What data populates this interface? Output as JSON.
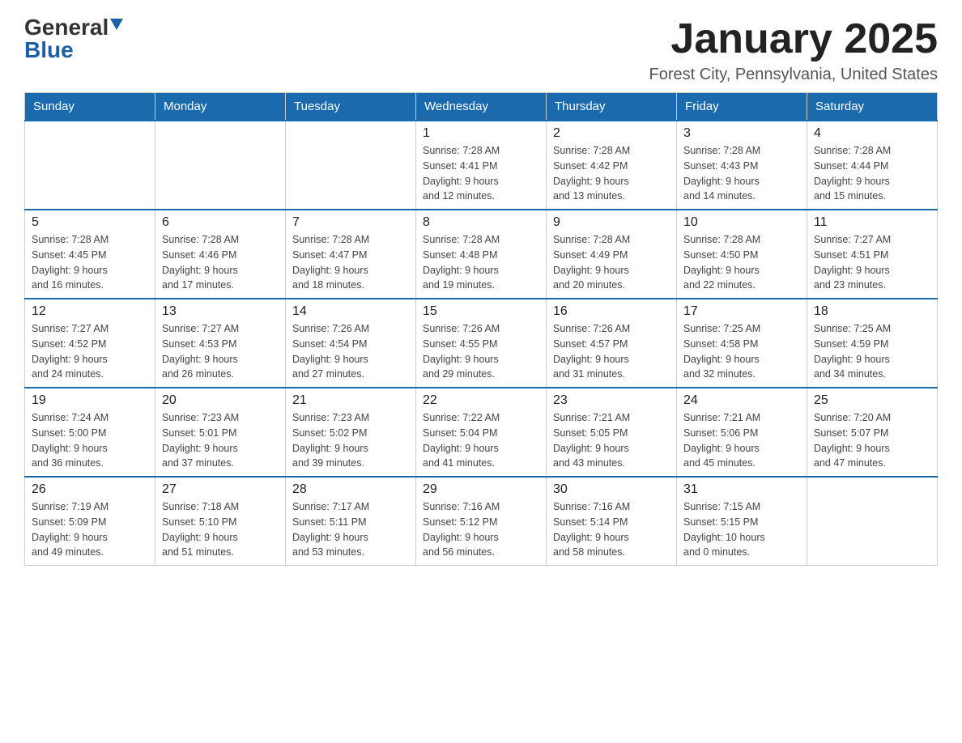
{
  "logo": {
    "general": "General",
    "blue": "Blue"
  },
  "header": {
    "title": "January 2025",
    "subtitle": "Forest City, Pennsylvania, United States"
  },
  "days_of_week": [
    "Sunday",
    "Monday",
    "Tuesday",
    "Wednesday",
    "Thursday",
    "Friday",
    "Saturday"
  ],
  "weeks": [
    [
      {
        "day": "",
        "info": ""
      },
      {
        "day": "",
        "info": ""
      },
      {
        "day": "",
        "info": ""
      },
      {
        "day": "1",
        "info": "Sunrise: 7:28 AM\nSunset: 4:41 PM\nDaylight: 9 hours\nand 12 minutes."
      },
      {
        "day": "2",
        "info": "Sunrise: 7:28 AM\nSunset: 4:42 PM\nDaylight: 9 hours\nand 13 minutes."
      },
      {
        "day": "3",
        "info": "Sunrise: 7:28 AM\nSunset: 4:43 PM\nDaylight: 9 hours\nand 14 minutes."
      },
      {
        "day": "4",
        "info": "Sunrise: 7:28 AM\nSunset: 4:44 PM\nDaylight: 9 hours\nand 15 minutes."
      }
    ],
    [
      {
        "day": "5",
        "info": "Sunrise: 7:28 AM\nSunset: 4:45 PM\nDaylight: 9 hours\nand 16 minutes."
      },
      {
        "day": "6",
        "info": "Sunrise: 7:28 AM\nSunset: 4:46 PM\nDaylight: 9 hours\nand 17 minutes."
      },
      {
        "day": "7",
        "info": "Sunrise: 7:28 AM\nSunset: 4:47 PM\nDaylight: 9 hours\nand 18 minutes."
      },
      {
        "day": "8",
        "info": "Sunrise: 7:28 AM\nSunset: 4:48 PM\nDaylight: 9 hours\nand 19 minutes."
      },
      {
        "day": "9",
        "info": "Sunrise: 7:28 AM\nSunset: 4:49 PM\nDaylight: 9 hours\nand 20 minutes."
      },
      {
        "day": "10",
        "info": "Sunrise: 7:28 AM\nSunset: 4:50 PM\nDaylight: 9 hours\nand 22 minutes."
      },
      {
        "day": "11",
        "info": "Sunrise: 7:27 AM\nSunset: 4:51 PM\nDaylight: 9 hours\nand 23 minutes."
      }
    ],
    [
      {
        "day": "12",
        "info": "Sunrise: 7:27 AM\nSunset: 4:52 PM\nDaylight: 9 hours\nand 24 minutes."
      },
      {
        "day": "13",
        "info": "Sunrise: 7:27 AM\nSunset: 4:53 PM\nDaylight: 9 hours\nand 26 minutes."
      },
      {
        "day": "14",
        "info": "Sunrise: 7:26 AM\nSunset: 4:54 PM\nDaylight: 9 hours\nand 27 minutes."
      },
      {
        "day": "15",
        "info": "Sunrise: 7:26 AM\nSunset: 4:55 PM\nDaylight: 9 hours\nand 29 minutes."
      },
      {
        "day": "16",
        "info": "Sunrise: 7:26 AM\nSunset: 4:57 PM\nDaylight: 9 hours\nand 31 minutes."
      },
      {
        "day": "17",
        "info": "Sunrise: 7:25 AM\nSunset: 4:58 PM\nDaylight: 9 hours\nand 32 minutes."
      },
      {
        "day": "18",
        "info": "Sunrise: 7:25 AM\nSunset: 4:59 PM\nDaylight: 9 hours\nand 34 minutes."
      }
    ],
    [
      {
        "day": "19",
        "info": "Sunrise: 7:24 AM\nSunset: 5:00 PM\nDaylight: 9 hours\nand 36 minutes."
      },
      {
        "day": "20",
        "info": "Sunrise: 7:23 AM\nSunset: 5:01 PM\nDaylight: 9 hours\nand 37 minutes."
      },
      {
        "day": "21",
        "info": "Sunrise: 7:23 AM\nSunset: 5:02 PM\nDaylight: 9 hours\nand 39 minutes."
      },
      {
        "day": "22",
        "info": "Sunrise: 7:22 AM\nSunset: 5:04 PM\nDaylight: 9 hours\nand 41 minutes."
      },
      {
        "day": "23",
        "info": "Sunrise: 7:21 AM\nSunset: 5:05 PM\nDaylight: 9 hours\nand 43 minutes."
      },
      {
        "day": "24",
        "info": "Sunrise: 7:21 AM\nSunset: 5:06 PM\nDaylight: 9 hours\nand 45 minutes."
      },
      {
        "day": "25",
        "info": "Sunrise: 7:20 AM\nSunset: 5:07 PM\nDaylight: 9 hours\nand 47 minutes."
      }
    ],
    [
      {
        "day": "26",
        "info": "Sunrise: 7:19 AM\nSunset: 5:09 PM\nDaylight: 9 hours\nand 49 minutes."
      },
      {
        "day": "27",
        "info": "Sunrise: 7:18 AM\nSunset: 5:10 PM\nDaylight: 9 hours\nand 51 minutes."
      },
      {
        "day": "28",
        "info": "Sunrise: 7:17 AM\nSunset: 5:11 PM\nDaylight: 9 hours\nand 53 minutes."
      },
      {
        "day": "29",
        "info": "Sunrise: 7:16 AM\nSunset: 5:12 PM\nDaylight: 9 hours\nand 56 minutes."
      },
      {
        "day": "30",
        "info": "Sunrise: 7:16 AM\nSunset: 5:14 PM\nDaylight: 9 hours\nand 58 minutes."
      },
      {
        "day": "31",
        "info": "Sunrise: 7:15 AM\nSunset: 5:15 PM\nDaylight: 10 hours\nand 0 minutes."
      },
      {
        "day": "",
        "info": ""
      }
    ]
  ]
}
